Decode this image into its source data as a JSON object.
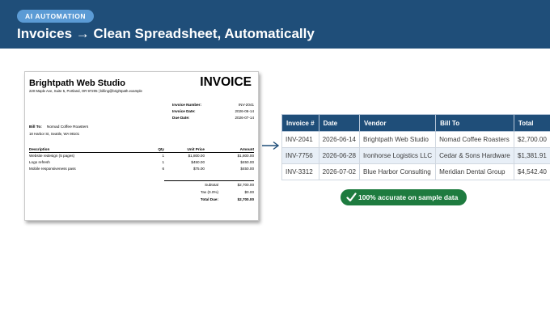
{
  "header": {
    "badge": "AI AUTOMATION",
    "title": "Invoices → Clean Spreadsheet, Automatically",
    "background": "#1f4e79",
    "badge_color": "#5b9bd5"
  },
  "invoice": {
    "company": "Brightpath Web Studio",
    "address": "220 Maple Ave, Suite 5, Portland, OR 97205 | billing@brightpath.example",
    "title": "INVOICE",
    "meta": [
      {
        "label": "Invoice Number:",
        "value": "INV-2041"
      },
      {
        "label": "Invoice Date:",
        "value": "2026-06-14"
      },
      {
        "label": "Due Date:",
        "value": "2026-07-14"
      }
    ],
    "bill_to_label": "Bill To:",
    "bill_to_name": "Nomad Coffee Roasters",
    "bill_to_address": "18 Harbor St, Seattle, WA 98101",
    "columns": {
      "description": "Description",
      "qty": "Qty",
      "unit_price": "Unit Price",
      "amount": "Amount"
    },
    "items": [
      {
        "description": "Website redesign (5 pages)",
        "qty": "1",
        "unit_price": "$1,800.00",
        "amount": "$1,800.00"
      },
      {
        "description": "Logo refresh",
        "qty": "1",
        "unit_price": "$450.00",
        "amount": "$450.00"
      },
      {
        "description": "Mobile responsiveness pass",
        "qty": "6",
        "unit_price": "$75.00",
        "amount": "$450.00"
      }
    ],
    "totals": [
      {
        "label": "Subtotal",
        "value": "$2,700.00"
      },
      {
        "label": "Tax (0.0%)",
        "value": "$0.00"
      },
      {
        "label": "Total Due:",
        "value": "$2,700.00"
      }
    ]
  },
  "arrow_icon": "arrow-right-icon",
  "spreadsheet": {
    "header_color": "#1f4e79",
    "columns": [
      "Invoice #",
      "Date",
      "Vendor",
      "Bill To",
      "Total"
    ],
    "rows": [
      [
        "INV-2041",
        "2026-06-14",
        "Brightpath Web Studio",
        "Nomad Coffee Roasters",
        "$2,700.00"
      ],
      [
        "INV-7756",
        "2026-06-28",
        "Ironhorse Logistics LLC",
        "Cedar & Sons Hardware",
        "$1,381.91"
      ],
      [
        "INV-3312",
        "2026-07-02",
        "Blue Harbor Consulting",
        "Meridian Dental Group",
        "$4,542.40"
      ]
    ]
  },
  "accuracy_badge": {
    "icon": "checkmark-icon",
    "text": "100% accurate on sample data",
    "color": "#1e7b3f"
  }
}
